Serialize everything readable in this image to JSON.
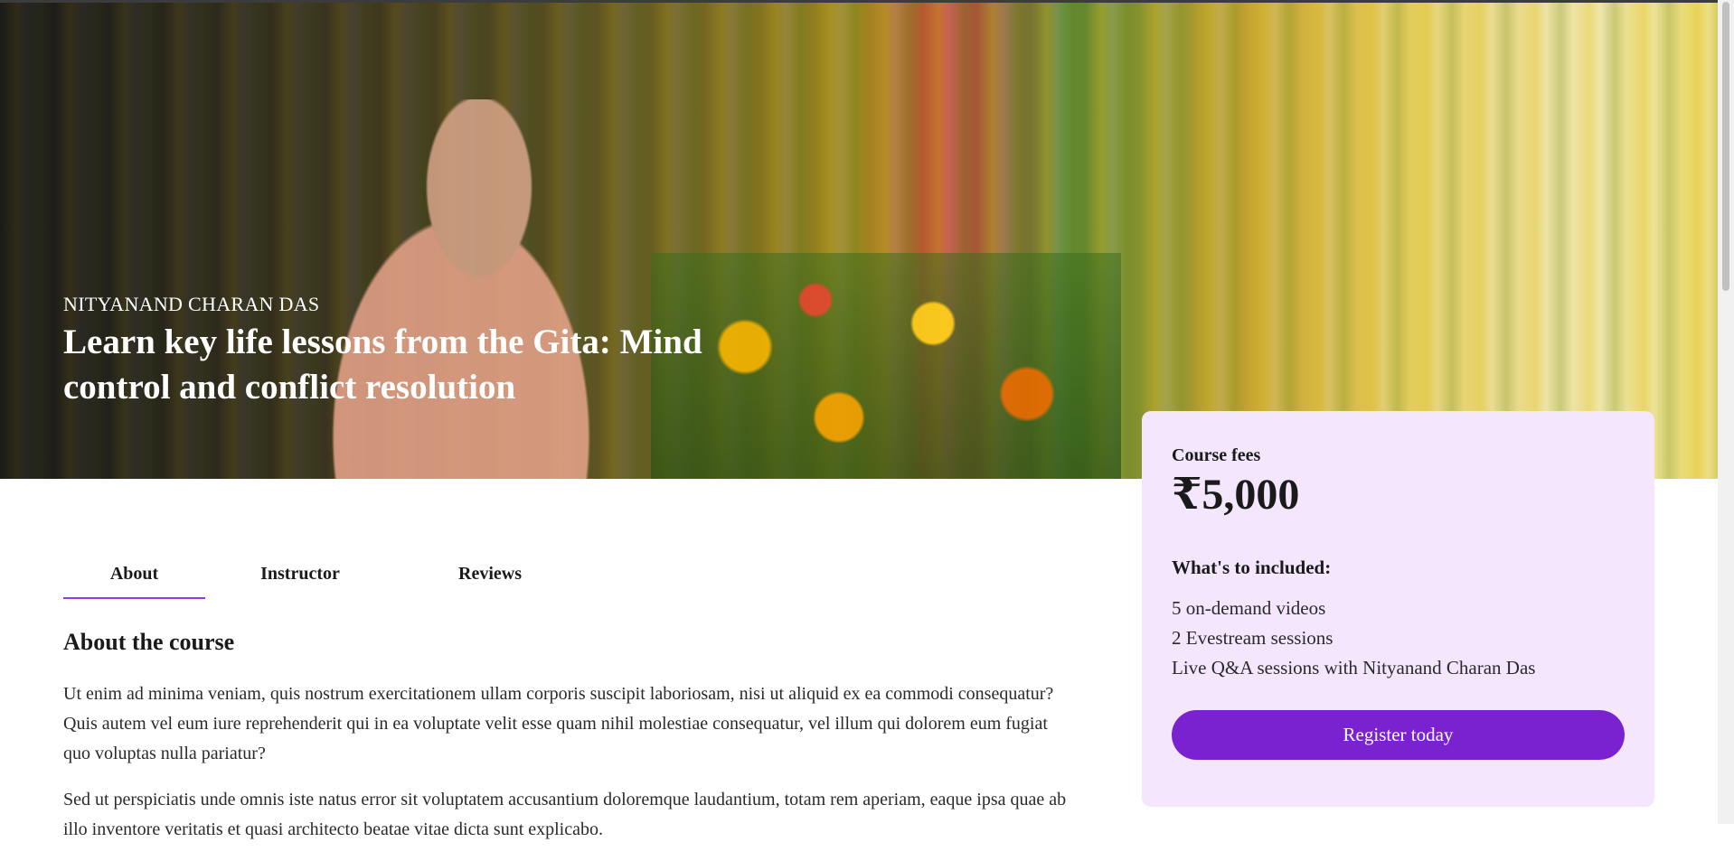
{
  "hero": {
    "author": "NITYANAND CHARAN DAS",
    "title": "Learn key life lessons from the Gita: Mind control and conflict resolution"
  },
  "tabs": [
    {
      "label": "About",
      "active": true
    },
    {
      "label": "Instructor",
      "active": false
    },
    {
      "label": "Reviews",
      "active": false
    }
  ],
  "about": {
    "heading": "About the course",
    "paragraphs": [
      "Ut enim ad minima veniam, quis nostrum exercitationem ullam corporis suscipit laboriosam, nisi ut aliquid ex ea commodi consequatur? Quis autem vel eum iure reprehenderit qui in ea voluptate velit esse quam nihil molestiae consequatur, vel illum qui dolorem eum fugiat quo voluptas nulla pariatur?",
      "Sed ut perspiciatis unde omnis iste natus error sit voluptatem accusantium doloremque laudantium, totam rem aperiam, eaque ipsa quae ab illo inventore veritatis et quasi architecto beatae vitae dicta sunt explicabo."
    ]
  },
  "fees": {
    "label": "Course fees",
    "price": "₹5,000",
    "included_title": "What's to included:",
    "included": [
      "5 on-demand videos",
      "2 Evestream sessions",
      "Live Q&A sessions with Nityanand Charan Das"
    ],
    "register_label": "Register today"
  },
  "colors": {
    "accent": "#7b22d0",
    "card_bg": "#f3e6fd",
    "tab_underline": "#8a3fe0"
  }
}
